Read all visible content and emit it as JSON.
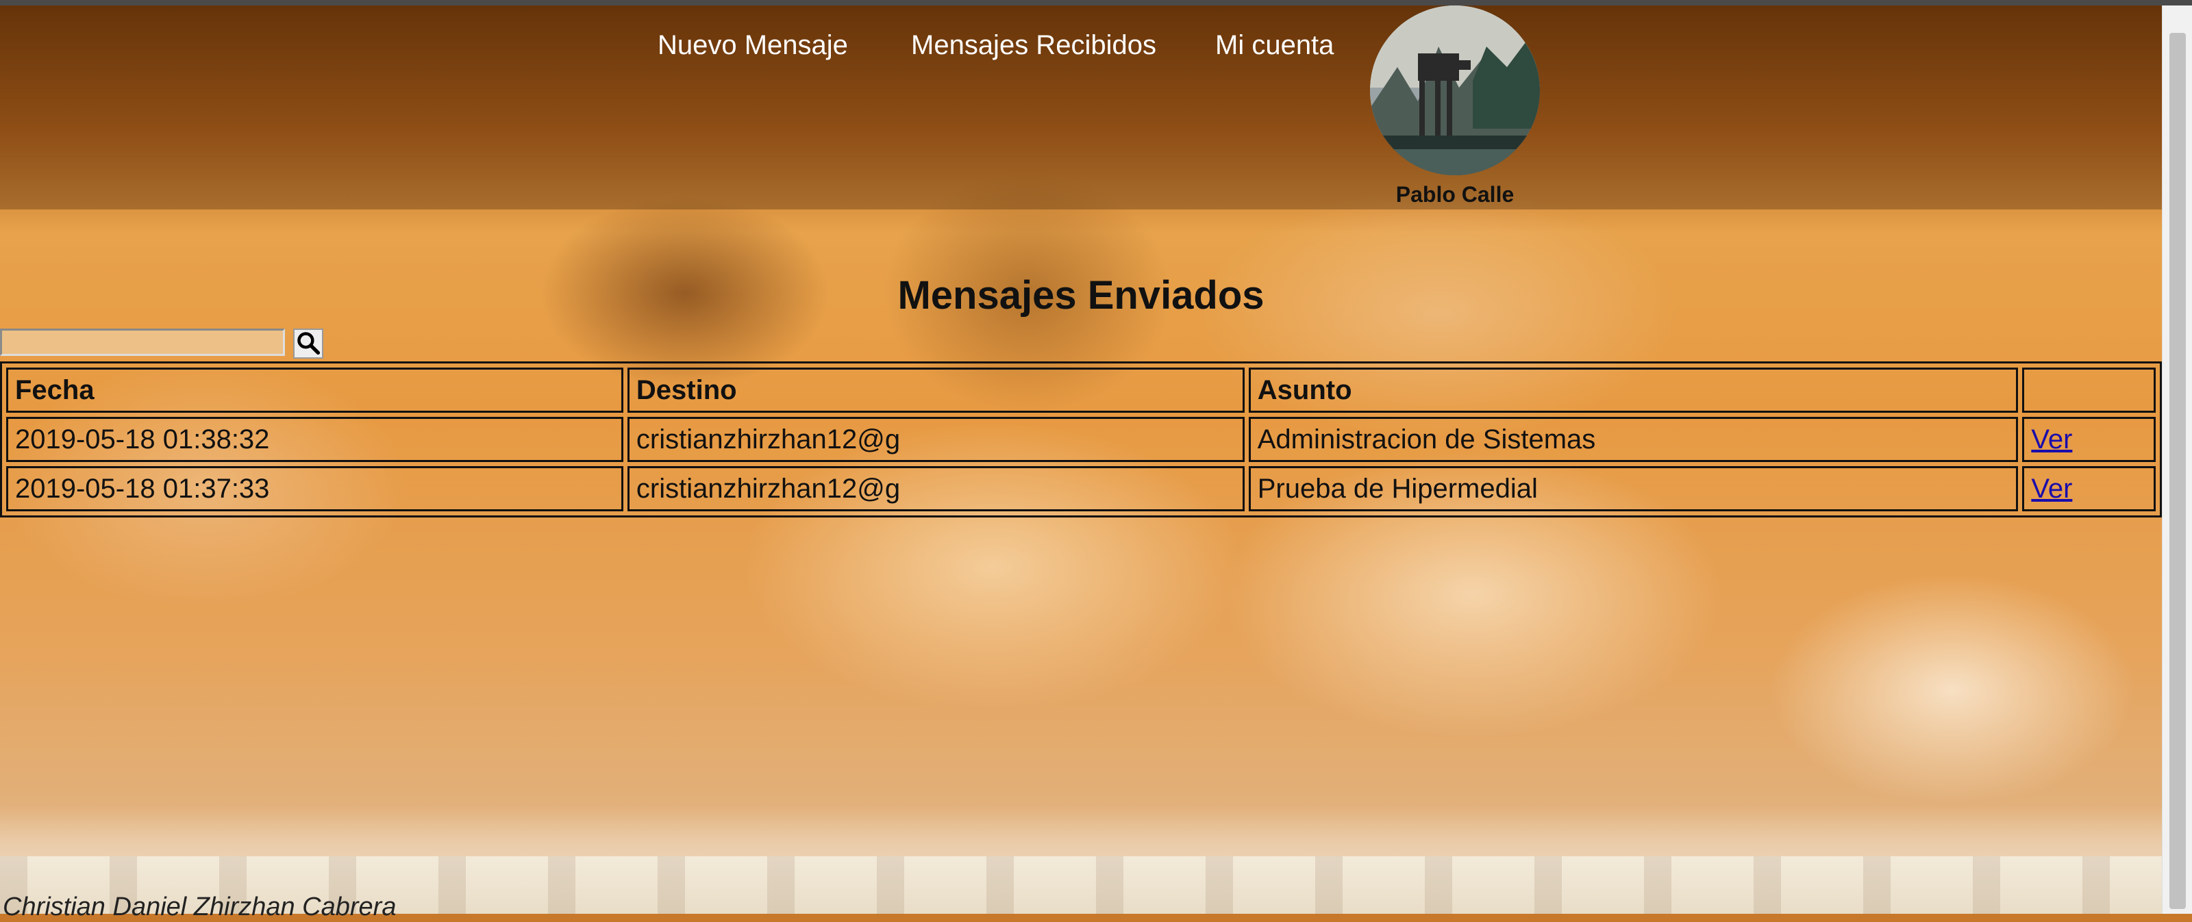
{
  "nav": {
    "new_message": "Nuevo Mensaje",
    "received": "Mensajes Recibidos",
    "account": "Mi cuenta"
  },
  "user": {
    "name": "Pablo Calle",
    "avatar_icon": "avatar-image"
  },
  "page": {
    "title": "Mensajes Enviados"
  },
  "search": {
    "value": "",
    "placeholder": "",
    "icon": "search-icon"
  },
  "table": {
    "headers": [
      "Fecha",
      "Destino",
      "Asunto",
      ""
    ],
    "rows": [
      {
        "fecha": "2019-05-18 01:38:32",
        "destino": "cristianzhirzhan12@g",
        "asunto": "Administracion de Sistemas",
        "action": "Ver"
      },
      {
        "fecha": "2019-05-18 01:37:33",
        "destino": "cristianzhirzhan12@g",
        "asunto": "Prueba de Hipermedial",
        "action": "Ver"
      }
    ]
  },
  "footer": {
    "author": "Christian Daniel Zhirzhan Cabrera"
  },
  "colors": {
    "link": "#1a0dab",
    "nav_text": "#ffffff",
    "text": "#111111"
  }
}
